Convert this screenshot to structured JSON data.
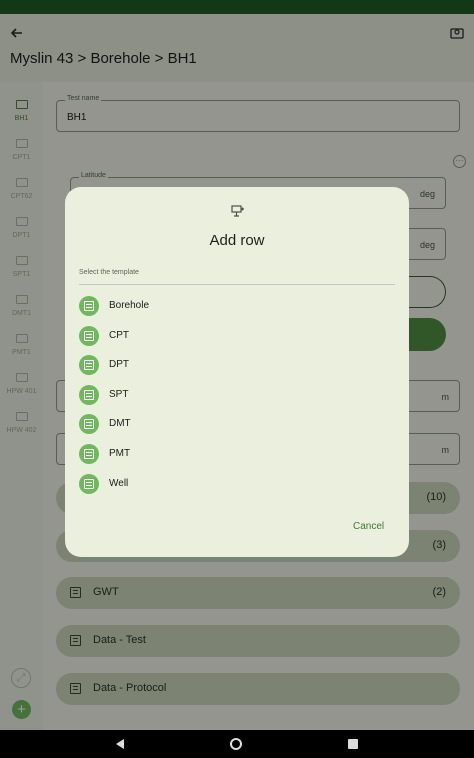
{
  "app_bar": {
    "title": "Myslin 43 > Borehole > BH1"
  },
  "rail": {
    "items": [
      {
        "label": "BH1",
        "active": true
      },
      {
        "label": "CPT1",
        "active": false
      },
      {
        "label": "CPT62",
        "active": false
      },
      {
        "label": "DPT1",
        "active": false
      },
      {
        "label": "SPT1",
        "active": false
      },
      {
        "label": "DMT1",
        "active": false
      },
      {
        "label": "PMT1",
        "active": false
      },
      {
        "label": "HPW 401",
        "active": false
      },
      {
        "label": "HPW 402",
        "active": false
      }
    ]
  },
  "form": {
    "test_name": {
      "label": "Test name",
      "value": "BH1"
    },
    "latitude": {
      "label": "Latitude",
      "unit": "deg"
    },
    "longitude": {
      "unit": "deg"
    },
    "field_m_1": {
      "unit": "m"
    },
    "field_m_2": {
      "unit": "m"
    }
  },
  "sections": [
    {
      "label": "",
      "count": "(10)"
    },
    {
      "label": "",
      "count": "(3)"
    },
    {
      "label": "GWT",
      "count": "(2)"
    },
    {
      "label": "Data - Test",
      "count": ""
    },
    {
      "label": "Data - Protocol",
      "count": ""
    }
  ],
  "dialog": {
    "title": "Add row",
    "subtitle": "Select the template",
    "options": [
      "Borehole",
      "CPT",
      "DPT",
      "SPT",
      "DMT",
      "PMT",
      "Well"
    ],
    "cancel_label": "Cancel"
  },
  "colors": {
    "status_bar": "#1f5a26",
    "accent": "#4f8c40",
    "option_icon": "#6fb85d",
    "dialog_bg": "#eaf0dd"
  },
  "icons": {
    "back": "arrow-left-icon",
    "map": "map-pin-icon",
    "dialog": "table-add-icon",
    "option": "list-icon"
  }
}
